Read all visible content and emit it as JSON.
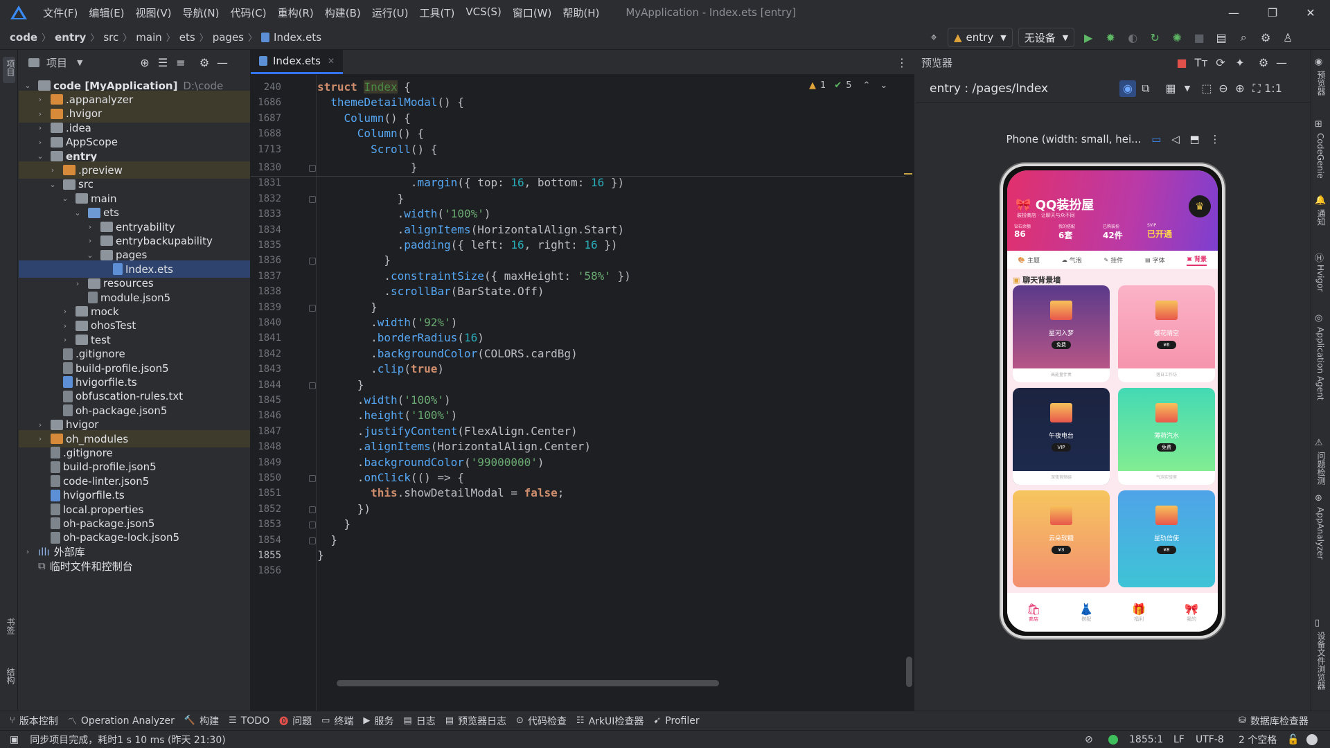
{
  "menubar": {
    "items": [
      "文件(F)",
      "编辑(E)",
      "视图(V)",
      "导航(N)",
      "代码(C)",
      "重构(R)",
      "构建(B)",
      "运行(U)",
      "工具(T)",
      "VCS(S)",
      "窗口(W)",
      "帮助(H)"
    ],
    "window_title": "MyApplication - Index.ets [entry]"
  },
  "breadcrumb": {
    "items": [
      "code",
      "entry",
      "src",
      "main",
      "ets",
      "pages",
      "Index.ets"
    ]
  },
  "toolbar": {
    "run_config": "entry",
    "device": "无设备"
  },
  "project_panel": {
    "title": "项目",
    "tree": [
      {
        "label": "code [MyApplication]",
        "extra": "D:\\code",
        "depth": 0,
        "chev": "v",
        "kind": "folder",
        "bold": true
      },
      {
        "label": ".appanalyzer",
        "depth": 1,
        "chev": ">",
        "kind": "folder-orange",
        "row": "hl"
      },
      {
        "label": ".hvigor",
        "depth": 1,
        "chev": ">",
        "kind": "folder-orange",
        "row": "hl"
      },
      {
        "label": ".idea",
        "depth": 1,
        "chev": ">",
        "kind": "folder"
      },
      {
        "label": "AppScope",
        "depth": 1,
        "chev": ">",
        "kind": "folder"
      },
      {
        "label": "entry",
        "depth": 1,
        "chev": "v",
        "kind": "folder",
        "bold": true
      },
      {
        "label": ".preview",
        "depth": 2,
        "chev": ">",
        "kind": "folder-orange",
        "row": "hl"
      },
      {
        "label": "src",
        "depth": 2,
        "chev": "v",
        "kind": "folder"
      },
      {
        "label": "main",
        "depth": 3,
        "chev": "v",
        "kind": "folder"
      },
      {
        "label": "ets",
        "depth": 4,
        "chev": "v",
        "kind": "folder-blue"
      },
      {
        "label": "entryability",
        "depth": 5,
        "chev": ">",
        "kind": "folder"
      },
      {
        "label": "entrybackupability",
        "depth": 5,
        "chev": ">",
        "kind": "folder"
      },
      {
        "label": "pages",
        "depth": 5,
        "chev": "v",
        "kind": "folder"
      },
      {
        "label": "Index.ets",
        "depth": 6,
        "chev": "",
        "kind": "file-ts",
        "row": "sel"
      },
      {
        "label": "resources",
        "depth": 4,
        "chev": ">",
        "kind": "folder"
      },
      {
        "label": "module.json5",
        "depth": 4,
        "chev": "",
        "kind": "file"
      },
      {
        "label": "mock",
        "depth": 3,
        "chev": ">",
        "kind": "folder"
      },
      {
        "label": "ohosTest",
        "depth": 3,
        "chev": ">",
        "kind": "folder"
      },
      {
        "label": "test",
        "depth": 3,
        "chev": ">",
        "kind": "folder"
      },
      {
        "label": ".gitignore",
        "depth": 2,
        "chev": "",
        "kind": "file"
      },
      {
        "label": "build-profile.json5",
        "depth": 2,
        "chev": "",
        "kind": "file"
      },
      {
        "label": "hvigorfile.ts",
        "depth": 2,
        "chev": "",
        "kind": "file-ts"
      },
      {
        "label": "obfuscation-rules.txt",
        "depth": 2,
        "chev": "",
        "kind": "file"
      },
      {
        "label": "oh-package.json5",
        "depth": 2,
        "chev": "",
        "kind": "file"
      },
      {
        "label": "hvigor",
        "depth": 1,
        "chev": ">",
        "kind": "folder"
      },
      {
        "label": "oh_modules",
        "depth": 1,
        "chev": ">",
        "kind": "folder-orange",
        "row": "hl"
      },
      {
        "label": ".gitignore",
        "depth": 1,
        "chev": "",
        "kind": "file"
      },
      {
        "label": "build-profile.json5",
        "depth": 1,
        "chev": "",
        "kind": "file"
      },
      {
        "label": "code-linter.json5",
        "depth": 1,
        "chev": "",
        "kind": "file"
      },
      {
        "label": "hvigorfile.ts",
        "depth": 1,
        "chev": "",
        "kind": "file-ts"
      },
      {
        "label": "local.properties",
        "depth": 1,
        "chev": "",
        "kind": "file"
      },
      {
        "label": "oh-package.json5",
        "depth": 1,
        "chev": "",
        "kind": "file"
      },
      {
        "label": "oh-package-lock.json5",
        "depth": 1,
        "chev": "",
        "kind": "file"
      },
      {
        "label": "外部库",
        "depth": 0,
        "chev": ">",
        "kind": "lib"
      },
      {
        "label": "临时文件和控制台",
        "depth": 0,
        "chev": "",
        "kind": "console"
      }
    ]
  },
  "editor": {
    "tab": "Index.ets",
    "warnings": "1",
    "checks": "5",
    "lines": [
      {
        "n": "240",
        "html": "<span class='kw'>struct</span> <span style='color:#4a8a42;background:#3b3a2c'>Index</span> {"
      },
      {
        "n": "1686",
        "html": "  <span class='fn'>themeDetailModal</span>() {"
      },
      {
        "n": "1687",
        "html": "    <span class='fn'>Column</span>() {"
      },
      {
        "n": "1688",
        "html": "      <span class='fn'>Column</span>() {"
      },
      {
        "n": "1713",
        "html": "        <span class='fn'>Scroll</span>() {"
      },
      {
        "n": "1830",
        "html": "              }"
      },
      {
        "n": "1831",
        "html": "              .<span class='fn'>margin</span>({ top: <span class='num'>16</span>, bottom: <span class='num'>16</span> })"
      },
      {
        "n": "1832",
        "html": "            }"
      },
      {
        "n": "1833",
        "html": "            .<span class='fn'>width</span>(<span class='str'>'100%'</span>)"
      },
      {
        "n": "1834",
        "html": "            .<span class='fn'>alignItems</span>(HorizontalAlign.Start)"
      },
      {
        "n": "1835",
        "html": "            .<span class='fn'>padding</span>({ left: <span class='num'>16</span>, right: <span class='num'>16</span> })"
      },
      {
        "n": "1836",
        "html": "          }"
      },
      {
        "n": "1837",
        "html": "          .<span class='fn'>constraintSize</span>({ maxHeight: <span class='str'>'58%'</span> })"
      },
      {
        "n": "1838",
        "html": "          .<span class='fn'>scrollBar</span>(BarState.Off)"
      },
      {
        "n": "1839",
        "html": "        }"
      },
      {
        "n": "1840",
        "html": "        .<span class='fn'>width</span>(<span class='str'>'92%'</span>)"
      },
      {
        "n": "1841",
        "html": "        .<span class='fn'>borderRadius</span>(<span class='num'>16</span>)"
      },
      {
        "n": "1842",
        "html": "        .<span class='fn'>backgroundColor</span>(COLORS.cardBg)"
      },
      {
        "n": "1843",
        "html": "        .<span class='fn'>clip</span>(<span class='kw'>true</span>)"
      },
      {
        "n": "1844",
        "html": "      }"
      },
      {
        "n": "1845",
        "html": "      .<span class='fn'>width</span>(<span class='str'>'100%'</span>)"
      },
      {
        "n": "1846",
        "html": "      .<span class='fn'>height</span>(<span class='str'>'100%'</span>)"
      },
      {
        "n": "1847",
        "html": "      .<span class='fn'>justifyContent</span>(FlexAlign.Center)"
      },
      {
        "n": "1848",
        "html": "      .<span class='fn'>alignItems</span>(HorizontalAlign.Center)"
      },
      {
        "n": "1849",
        "html": "      .<span class='fn'>backgroundColor</span>(<span class='str'>'99000000'</span>)"
      },
      {
        "n": "1850",
        "html": "      .<span class='fn'>onClick</span>(() => {"
      },
      {
        "n": "1851",
        "html": "        <span class='kw'>this</span>.showDetailModal = <span class='kw'>false</span>;"
      },
      {
        "n": "1852",
        "html": "      })"
      },
      {
        "n": "1853",
        "html": "    }"
      },
      {
        "n": "1854",
        "html": "  }"
      },
      {
        "n": "1855",
        "html": "}"
      },
      {
        "n": "1856",
        "html": ""
      }
    ]
  },
  "preview": {
    "panel_title": "预览器",
    "route": "entry : /pages/Index",
    "device_label": "Phone (width: small, hei...",
    "app": {
      "title": "QQ装扮屋",
      "subtitle": "装扮商店 · 让聊天与众不同",
      "stats": [
        {
          "label": "钻石余额",
          "value": "86"
        },
        {
          "label": "我的搭配",
          "value": "6套"
        },
        {
          "label": "已购装扮",
          "value": "42件"
        },
        {
          "label": "SVIP",
          "value": "已开通"
        }
      ],
      "tabs": [
        "主题",
        "气泡",
        "挂件",
        "字体",
        "背景"
      ],
      "section_title": "聊天背景墙",
      "cards": [
        {
          "title": "星河入梦",
          "badge": "免费",
          "foot": "高能量伴奏"
        },
        {
          "title": "樱花晴空",
          "badge": "¥6",
          "foot": "落日工作坊"
        },
        {
          "title": "午夜电台",
          "badge": "VIP",
          "foot": "深夜音频组"
        },
        {
          "title": "薄荷汽水",
          "badge": "免费",
          "foot": "气泡实验室"
        },
        {
          "title": "云朵软糖",
          "badge": "¥3",
          "foot": ""
        },
        {
          "title": "星轨信使",
          "badge": "¥8",
          "foot": ""
        }
      ],
      "bottom_nav": [
        "商店",
        "搭配",
        "福利",
        "我的"
      ]
    }
  },
  "right_strip": [
    "预览器",
    "CodeGenie",
    "通知",
    "Hvigor",
    "Application Agent",
    "问题检测",
    "AppAnalyzer",
    "设备文件浏览器"
  ],
  "left_strip": {
    "top": "项目",
    "bottom": [
      "书签",
      "结构"
    ]
  },
  "bottom_tools": [
    "版本控制",
    "Operation Analyzer",
    "构建",
    "TODO",
    "问题",
    "终端",
    "服务",
    "日志",
    "预览器日志",
    "代码检查",
    "ArkUI检查器",
    "Profiler",
    "数据库检查器"
  ],
  "status": {
    "message": "同步项目完成，耗时1 s 10 ms (昨天 21:30)",
    "position": "1855:1",
    "line_sep": "LF",
    "encoding": "UTF-8",
    "indent": "2 个空格"
  }
}
